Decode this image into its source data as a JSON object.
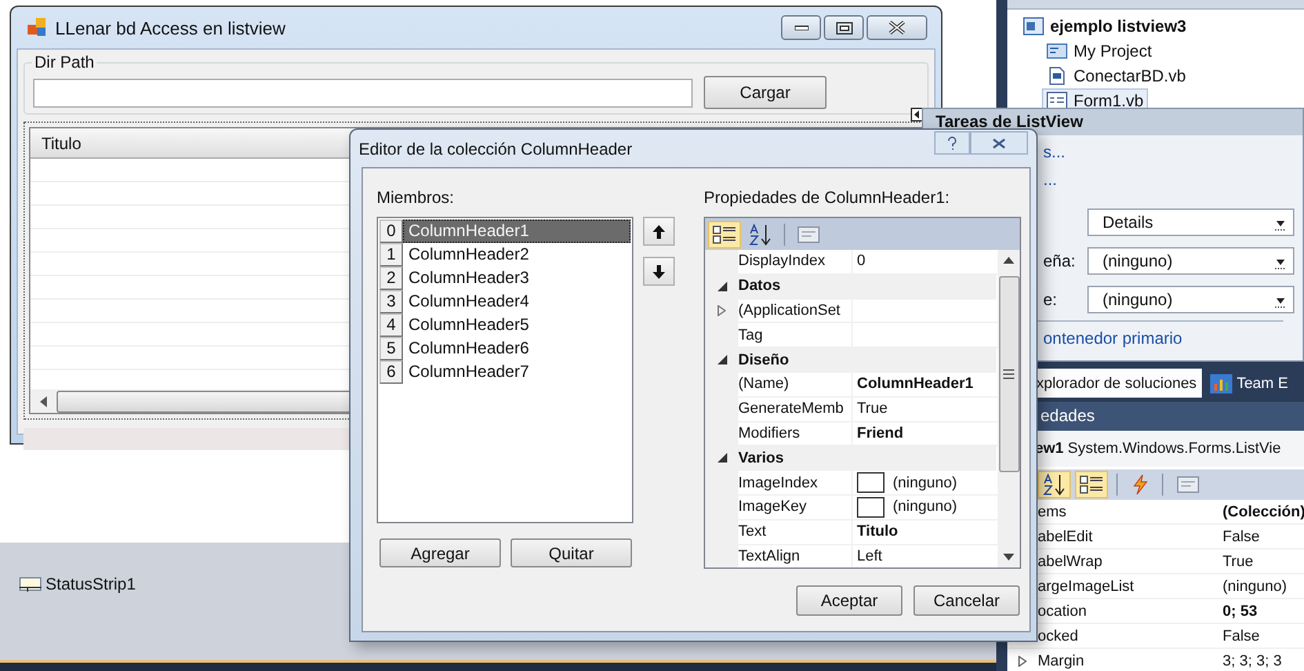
{
  "designer": {
    "title": "LLenar bd Access en listview",
    "group_label": "Dir Path",
    "load_button": "Cargar",
    "list_columns": [
      "Titulo"
    ]
  },
  "component_tray": [
    {
      "label": "StatusStrip1"
    }
  ],
  "solution_tree": [
    {
      "label": "ejemplo listview3",
      "kind": "solution",
      "selected": false,
      "children": [
        {
          "label": "My Project",
          "kind": "project",
          "selected": false
        },
        {
          "label": "ConectarBD.vb",
          "kind": "module",
          "selected": false
        },
        {
          "label": "Form1.vb",
          "kind": "form",
          "selected": true
        }
      ]
    }
  ],
  "listview_tasks": {
    "title": "Tareas de ListView",
    "links": [
      "s...",
      "..."
    ],
    "fields": [
      {
        "value": "Details"
      },
      {
        "label": "eña:",
        "value": "(ninguno)"
      },
      {
        "label": "e:",
        "value": "(ninguno)"
      }
    ],
    "parent_link": "ontenedor primario"
  },
  "dock_tabs": [
    {
      "label": "xplorador de soluciones",
      "selected": true
    },
    {
      "label": "Team E",
      "selected": false
    }
  ],
  "properties": {
    "title": "edades",
    "object_name": "ew1",
    "object_type": "System.Windows.Forms.ListVie",
    "toolbar": [
      {
        "kind": "alphabetical",
        "selected": true
      },
      {
        "kind": "categorized",
        "selected": true
      },
      {
        "kind": "events",
        "selected": false
      },
      {
        "kind": "pages",
        "selected": false
      }
    ],
    "rows": [
      {
        "kind": "property",
        "name": "ems",
        "value": "(Colección)",
        "bold": true
      },
      {
        "kind": "property",
        "name": "abelEdit",
        "value": "False",
        "bold": false
      },
      {
        "kind": "property",
        "name": "abelWrap",
        "value": "True",
        "bold": false
      },
      {
        "kind": "property",
        "name": "argeImageList",
        "value": "(ninguno)",
        "bold": false
      },
      {
        "kind": "property",
        "name": "ocation",
        "value": "0; 53",
        "bold": true
      },
      {
        "kind": "property",
        "name": "ocked",
        "value": "False",
        "bold": false
      },
      {
        "kind": "expandable",
        "name": "Margin",
        "value": "3; 3; 3; 3",
        "bold": false
      }
    ]
  },
  "collection_editor": {
    "title": "Editor de la colección ColumnHeader",
    "members_label": "Miembros:",
    "members": [
      {
        "index": "0",
        "name": "ColumnHeader1",
        "selected": true
      },
      {
        "index": "1",
        "name": "ColumnHeader2",
        "selected": false
      },
      {
        "index": "2",
        "name": "ColumnHeader3",
        "selected": false
      },
      {
        "index": "3",
        "name": "ColumnHeader4",
        "selected": false
      },
      {
        "index": "4",
        "name": "ColumnHeader5",
        "selected": false
      },
      {
        "index": "5",
        "name": "ColumnHeader6",
        "selected": false
      },
      {
        "index": "6",
        "name": "ColumnHeader7",
        "selected": false
      }
    ],
    "add_button": "Agregar",
    "remove_button": "Quitar",
    "properties_label": "Propiedades de ColumnHeader1:",
    "grid_toolbar": [
      {
        "kind": "categorized",
        "selected": true
      },
      {
        "kind": "alphabetical",
        "selected": false
      },
      {
        "kind": "pages",
        "selected": false
      }
    ],
    "grid": [
      {
        "kind": "property",
        "name": "DisplayIndex",
        "value": "0",
        "bold": false
      },
      {
        "kind": "category",
        "name": "Datos",
        "expanded": true
      },
      {
        "kind": "expandable",
        "name": "(ApplicationSet"
      },
      {
        "kind": "property",
        "name": "Tag"
      },
      {
        "kind": "category",
        "name": "Diseño",
        "expanded": true
      },
      {
        "kind": "property",
        "name": "(Name)",
        "value": "ColumnHeader1",
        "bold": true
      },
      {
        "kind": "property",
        "name": "GenerateMemb",
        "value": "True",
        "bold": false
      },
      {
        "kind": "property",
        "name": "Modifiers",
        "value": "Friend",
        "bold": true
      },
      {
        "kind": "category",
        "name": "Varios",
        "expanded": true
      },
      {
        "kind": "image",
        "name": "ImageIndex",
        "value": "(ninguno)",
        "bold": false
      },
      {
        "kind": "image",
        "name": "ImageKey",
        "value": "(ninguno)",
        "bold": false
      },
      {
        "kind": "property",
        "name": "Text",
        "value": "Titulo",
        "bold": true
      },
      {
        "kind": "property",
        "name": "TextAlign",
        "value": "Left",
        "bold": false
      }
    ],
    "ok_button": "Aceptar",
    "cancel_button": "Cancelar"
  }
}
